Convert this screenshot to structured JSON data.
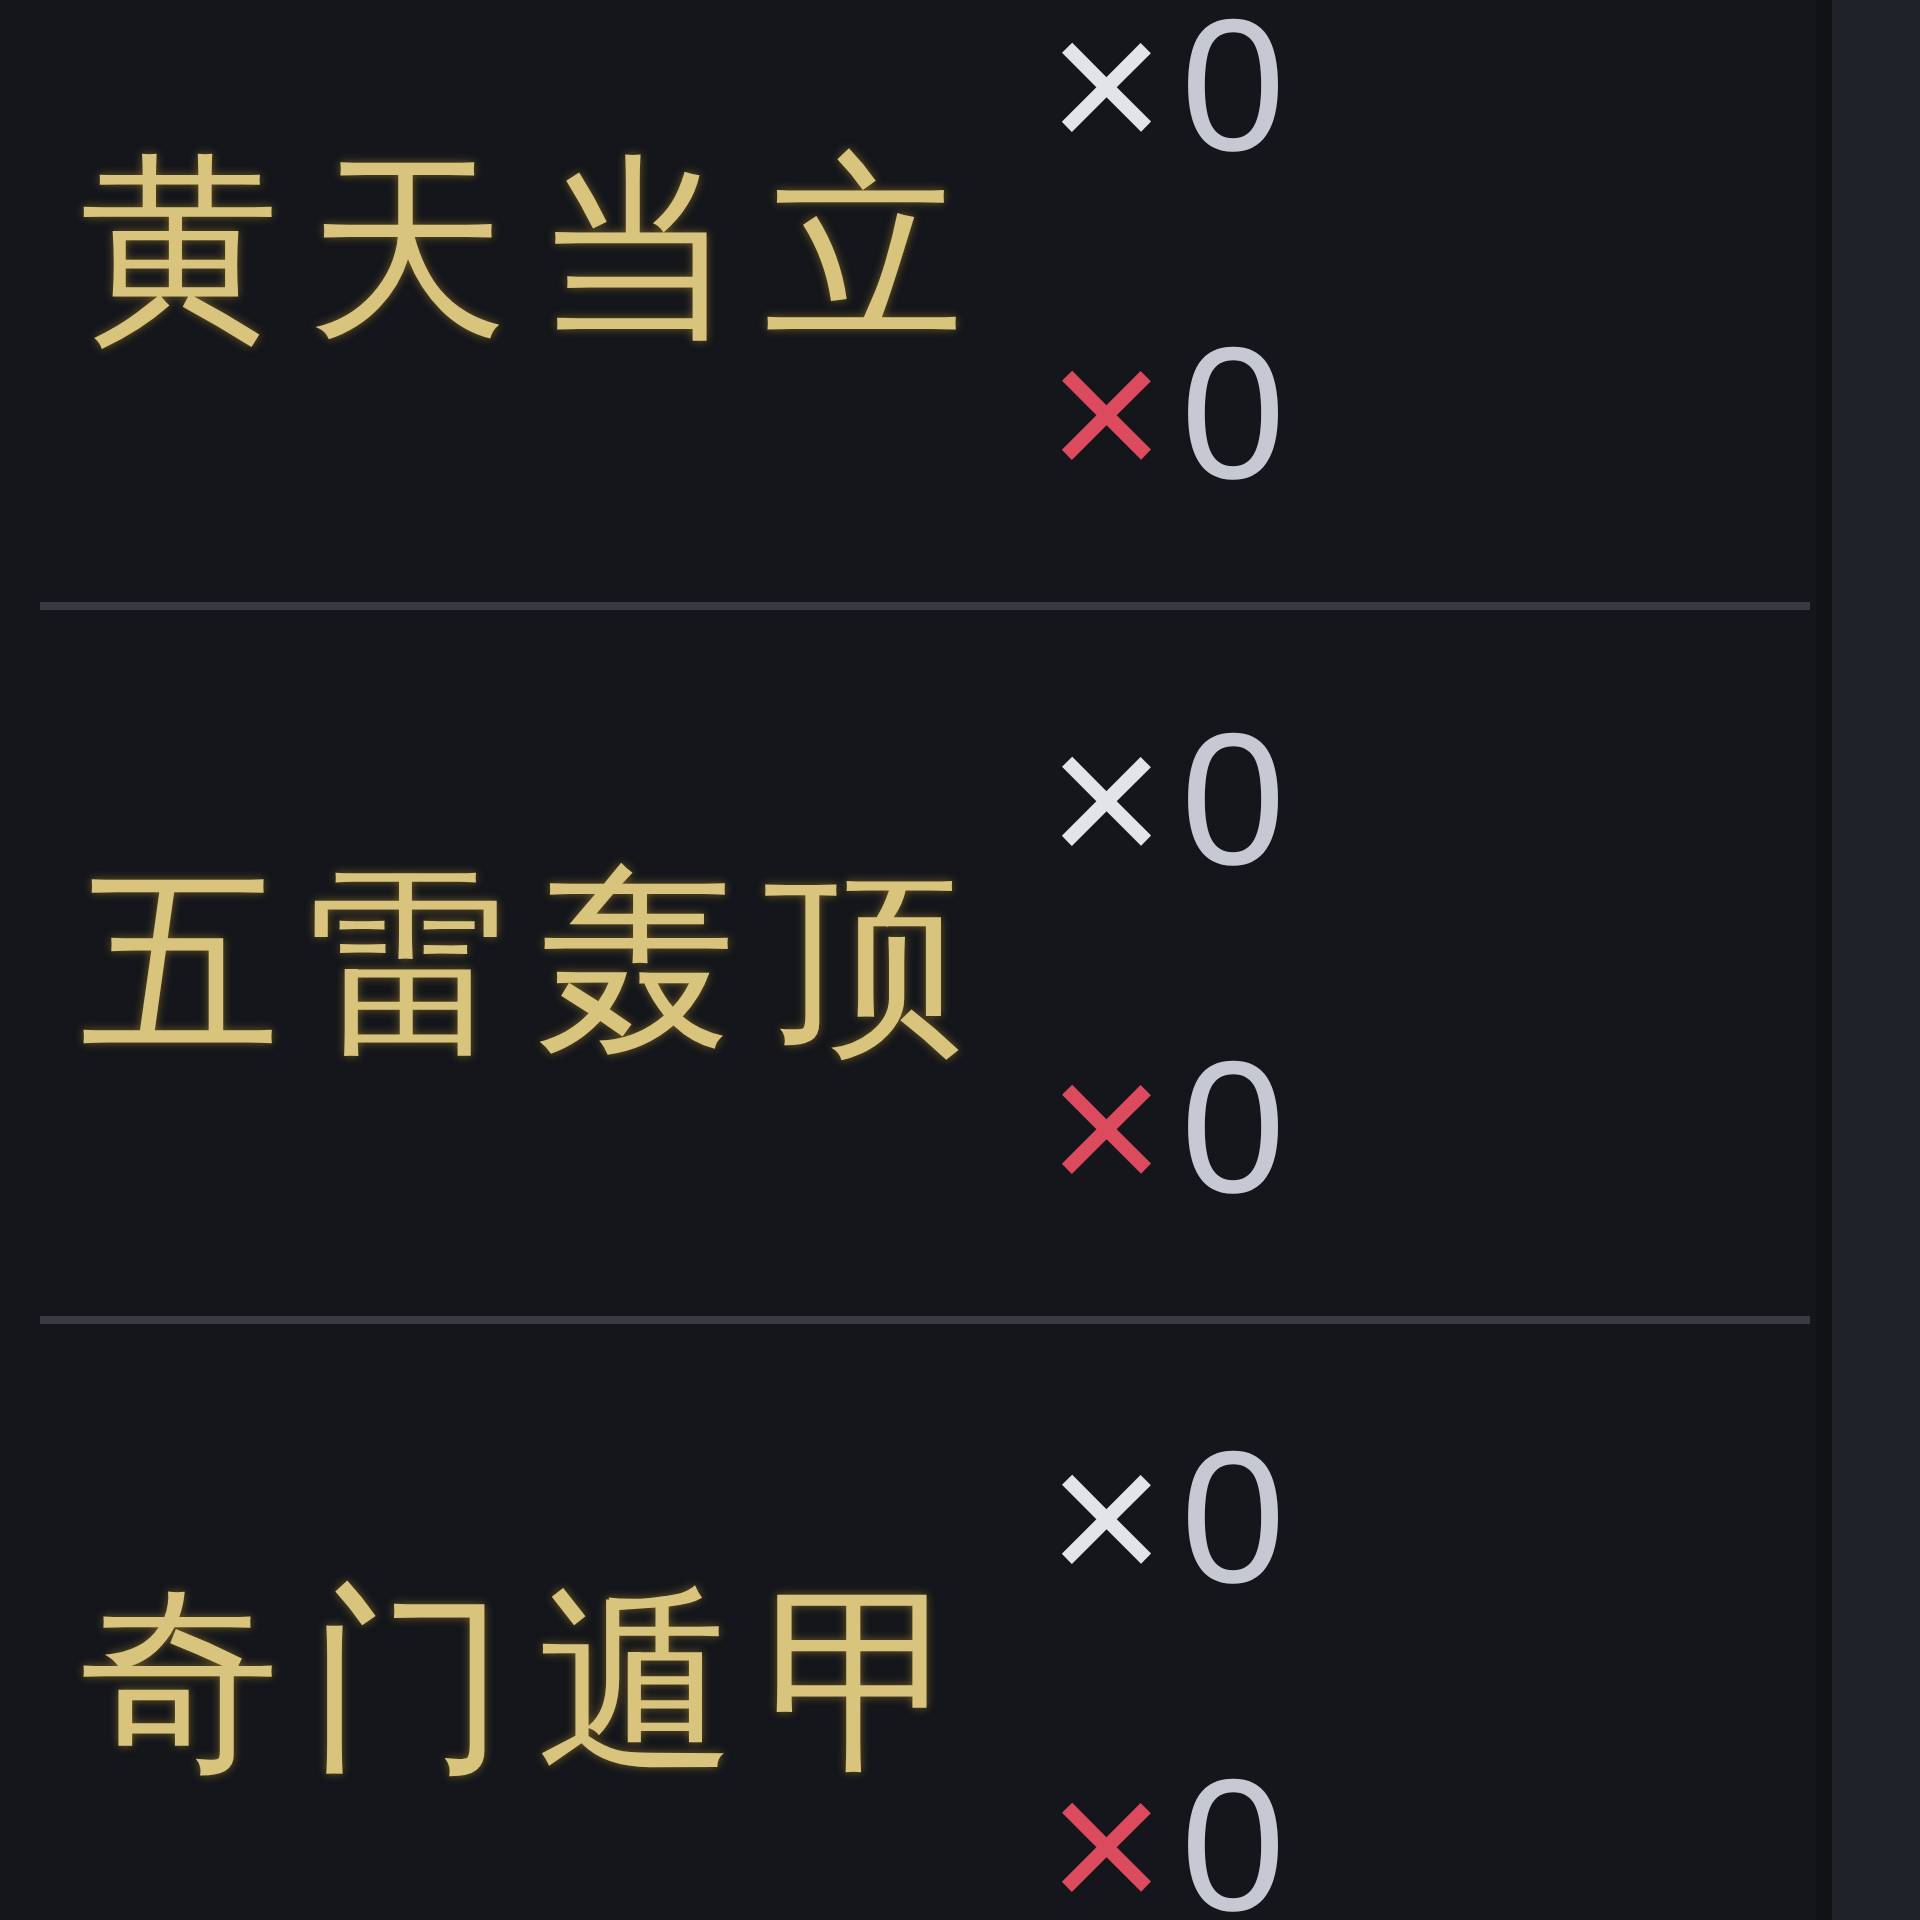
{
  "skills": [
    {
      "name": "黄天当立",
      "counters": [
        {
          "symbol": "×",
          "count": "0",
          "color": "#e2e4e8"
        },
        {
          "symbol": "×",
          "count": "0",
          "color": "#dc4a5e"
        }
      ]
    },
    {
      "name": "五雷轰顶",
      "counters": [
        {
          "symbol": "×",
          "count": "0",
          "color": "#e2e4e8"
        },
        {
          "symbol": "×",
          "count": "0",
          "color": "#dc4a5e"
        }
      ]
    },
    {
      "name": "奇门遁甲",
      "counters": [
        {
          "symbol": "×",
          "count": "0",
          "color": "#e2e4e8"
        },
        {
          "symbol": "×",
          "count": "0",
          "color": "#dc4a5e"
        }
      ]
    }
  ]
}
